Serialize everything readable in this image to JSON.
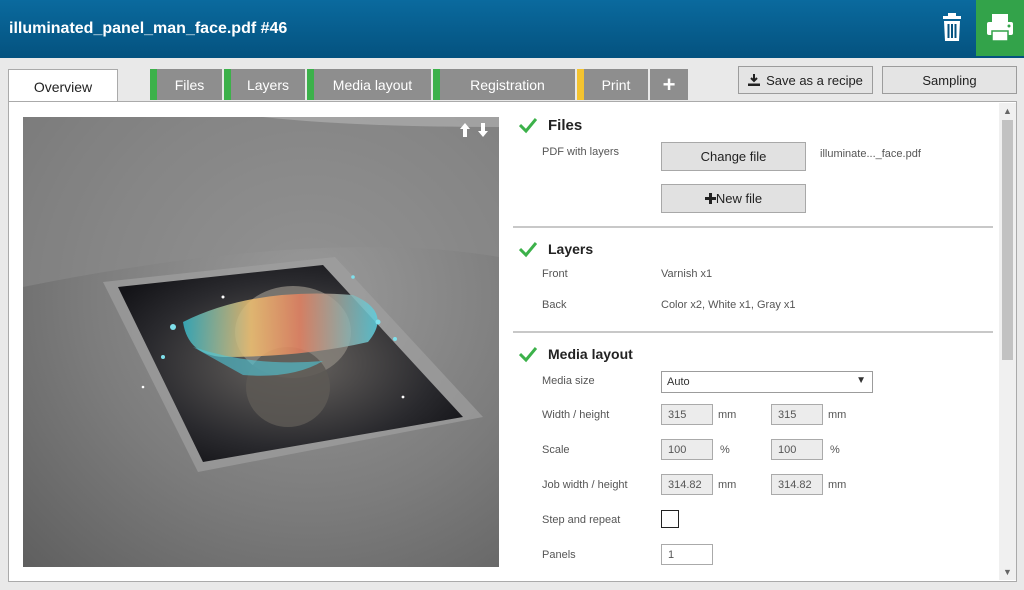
{
  "header": {
    "title": "illuminated_panel_man_face.pdf #46",
    "trash_icon": "trash-icon",
    "print_icon": "printer-icon"
  },
  "tabs": [
    {
      "label": "Overview",
      "active": true
    },
    {
      "label": "Files",
      "status_color": "#3cb14a"
    },
    {
      "label": "Layers",
      "status_color": "#3cb14a"
    },
    {
      "label": "Media layout",
      "status_color": "#3cb14a"
    },
    {
      "label": "Registration",
      "status_color": "#3cb14a"
    },
    {
      "label": "Print",
      "status_color": "#f4c430"
    },
    {
      "label": "+"
    }
  ],
  "actions": {
    "save_recipe": "Save as a recipe",
    "sampling": "Sampling"
  },
  "sections": {
    "files": {
      "title": "Files",
      "pdf_label": "PDF with layers",
      "change_file": "Change file",
      "new_file": "New file",
      "filename": "illuminate..._face.pdf"
    },
    "layers": {
      "title": "Layers",
      "front_label": "Front",
      "front_value": "Varnish x1",
      "back_label": "Back",
      "back_value": "Color x2, White x1, Gray x1"
    },
    "media_layout": {
      "title": "Media layout",
      "media_size_label": "Media size",
      "media_size_value": "Auto",
      "width_height_label": "Width / height",
      "width": "315",
      "height": "315",
      "scale_label": "Scale",
      "scale_x": "100",
      "scale_y": "100",
      "job_wh_label": "Job width / height",
      "job_width": "314.82",
      "job_height": "314.82",
      "step_repeat_label": "Step and repeat",
      "panels_label": "Panels",
      "panels_value": "1",
      "unit_mm": "mm",
      "unit_pct": "%"
    }
  },
  "colors": {
    "header": "#04527f",
    "ok": "#3cb14a",
    "warn": "#f4c430",
    "print": "#33a34a"
  }
}
